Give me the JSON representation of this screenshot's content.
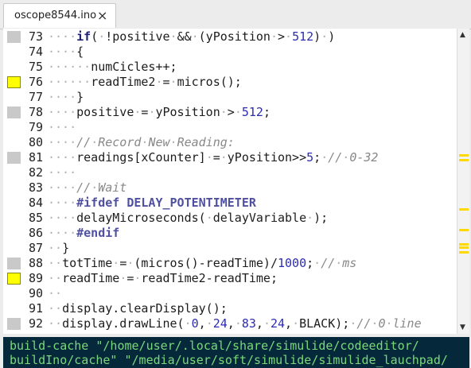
{
  "tab": {
    "title": "oscope8544.ino",
    "close_icon": "×"
  },
  "editor": {
    "lines": [
      {
        "num": "73",
        "marker": "gray",
        "tokens": [
          {
            "t": "····",
            "c": "dot"
          },
          {
            "t": "if",
            "c": "kw"
          },
          {
            "t": "("
          },
          {
            "t": "·",
            "c": "dot"
          },
          {
            "t": "!positive"
          },
          {
            "t": "·",
            "c": "dot"
          },
          {
            "t": "&&"
          },
          {
            "t": "·",
            "c": "dot"
          },
          {
            "t": "(yPosition"
          },
          {
            "t": "·",
            "c": "dot"
          },
          {
            "t": ">"
          },
          {
            "t": "·",
            "c": "dot"
          },
          {
            "t": "512",
            "c": "num"
          },
          {
            "t": ")"
          },
          {
            "t": "·",
            "c": "dot"
          },
          {
            "t": ")"
          }
        ]
      },
      {
        "num": "74",
        "marker": "none",
        "tokens": [
          {
            "t": "····",
            "c": "dot"
          },
          {
            "t": "{"
          }
        ]
      },
      {
        "num": "75",
        "marker": "none",
        "tokens": [
          {
            "t": "······",
            "c": "dot"
          },
          {
            "t": "numCicles++;"
          }
        ]
      },
      {
        "num": "76",
        "marker": "yellow",
        "tokens": [
          {
            "t": "······",
            "c": "dot"
          },
          {
            "t": "readTime2"
          },
          {
            "t": "·",
            "c": "dot"
          },
          {
            "t": "="
          },
          {
            "t": "·",
            "c": "dot"
          },
          {
            "t": "micros();"
          }
        ]
      },
      {
        "num": "77",
        "marker": "none",
        "tokens": [
          {
            "t": "····",
            "c": "dot"
          },
          {
            "t": "}"
          }
        ]
      },
      {
        "num": "78",
        "marker": "gray",
        "tokens": [
          {
            "t": "····",
            "c": "dot"
          },
          {
            "t": "positive"
          },
          {
            "t": "·",
            "c": "dot"
          },
          {
            "t": "="
          },
          {
            "t": "·",
            "c": "dot"
          },
          {
            "t": "yPosition"
          },
          {
            "t": "·",
            "c": "dot"
          },
          {
            "t": ">"
          },
          {
            "t": "·",
            "c": "dot"
          },
          {
            "t": "512",
            "c": "num"
          },
          {
            "t": ";"
          }
        ]
      },
      {
        "num": "79",
        "marker": "none",
        "tokens": [
          {
            "t": "····",
            "c": "dot"
          }
        ]
      },
      {
        "num": "80",
        "marker": "none",
        "tokens": [
          {
            "t": "····",
            "c": "dot"
          },
          {
            "t": "//",
            "c": "cm"
          },
          {
            "t": "·",
            "c": "dot"
          },
          {
            "t": "Record",
            "c": "cm"
          },
          {
            "t": "·",
            "c": "dot"
          },
          {
            "t": "New",
            "c": "cm"
          },
          {
            "t": "·",
            "c": "dot"
          },
          {
            "t": "Reading:",
            "c": "cm"
          }
        ]
      },
      {
        "num": "81",
        "marker": "gray",
        "tokens": [
          {
            "t": "····",
            "c": "dot"
          },
          {
            "t": "readings[xCounter]"
          },
          {
            "t": "·",
            "c": "dot"
          },
          {
            "t": "="
          },
          {
            "t": "·",
            "c": "dot"
          },
          {
            "t": "yPosition>>"
          },
          {
            "t": "5",
            "c": "num"
          },
          {
            "t": ";"
          },
          {
            "t": "·",
            "c": "dot"
          },
          {
            "t": "//",
            "c": "cm"
          },
          {
            "t": "·",
            "c": "dot"
          },
          {
            "t": "0-32",
            "c": "cm"
          }
        ]
      },
      {
        "num": "82",
        "marker": "none",
        "tokens": [
          {
            "t": "····",
            "c": "dot"
          }
        ]
      },
      {
        "num": "83",
        "marker": "none",
        "tokens": [
          {
            "t": "····",
            "c": "dot"
          },
          {
            "t": "//",
            "c": "cm"
          },
          {
            "t": "·",
            "c": "dot"
          },
          {
            "t": "Wait",
            "c": "cm"
          }
        ]
      },
      {
        "num": "84",
        "marker": "none",
        "tokens": [
          {
            "t": "····",
            "c": "dot"
          },
          {
            "t": "#ifdef",
            "c": "pp"
          },
          {
            "t": " "
          },
          {
            "t": "DELAY_POTENTIMETER",
            "c": "pp"
          }
        ]
      },
      {
        "num": "85",
        "marker": "none",
        "tokens": [
          {
            "t": "····",
            "c": "dot"
          },
          {
            "t": "delayMicroseconds("
          },
          {
            "t": "·",
            "c": "dot"
          },
          {
            "t": "delayVariable"
          },
          {
            "t": "·",
            "c": "dot"
          },
          {
            "t": ");"
          }
        ]
      },
      {
        "num": "86",
        "marker": "none",
        "tokens": [
          {
            "t": "····",
            "c": "dot"
          },
          {
            "t": "#endif",
            "c": "pp"
          }
        ]
      },
      {
        "num": "87",
        "marker": "none",
        "tokens": [
          {
            "t": "··",
            "c": "dot"
          },
          {
            "t": "}"
          }
        ]
      },
      {
        "num": "88",
        "marker": "gray",
        "tokens": [
          {
            "t": "··",
            "c": "dot"
          },
          {
            "t": "totTime"
          },
          {
            "t": "·",
            "c": "dot"
          },
          {
            "t": "="
          },
          {
            "t": "·",
            "c": "dot"
          },
          {
            "t": "(micros()-readTime)/"
          },
          {
            "t": "1000",
            "c": "num"
          },
          {
            "t": ";"
          },
          {
            "t": "·",
            "c": "dot"
          },
          {
            "t": "//",
            "c": "cm"
          },
          {
            "t": "·",
            "c": "dot"
          },
          {
            "t": "ms",
            "c": "cm"
          }
        ]
      },
      {
        "num": "89",
        "marker": "yellow",
        "tokens": [
          {
            "t": "··",
            "c": "dot"
          },
          {
            "t": "readTime"
          },
          {
            "t": "·",
            "c": "dot"
          },
          {
            "t": "="
          },
          {
            "t": "·",
            "c": "dot"
          },
          {
            "t": "readTime2-readTime;"
          }
        ]
      },
      {
        "num": "90",
        "marker": "none",
        "tokens": [
          {
            "t": "··",
            "c": "dot"
          }
        ]
      },
      {
        "num": "91",
        "marker": "none",
        "tokens": [
          {
            "t": "··",
            "c": "dot"
          },
          {
            "t": "display.clearDisplay();"
          }
        ]
      },
      {
        "num": "92",
        "marker": "gray",
        "tokens": [
          {
            "t": "··",
            "c": "dot"
          },
          {
            "t": "display.drawLine("
          },
          {
            "t": "·",
            "c": "dot"
          },
          {
            "t": "0",
            "c": "num"
          },
          {
            "t": ","
          },
          {
            "t": "·",
            "c": "dot"
          },
          {
            "t": "24",
            "c": "num"
          },
          {
            "t": ","
          },
          {
            "t": "·",
            "c": "dot"
          },
          {
            "t": "83",
            "c": "num"
          },
          {
            "t": ","
          },
          {
            "t": "·",
            "c": "dot"
          },
          {
            "t": "24",
            "c": "num"
          },
          {
            "t": ","
          },
          {
            "t": "·",
            "c": "dot"
          },
          {
            "t": "BLACK);"
          },
          {
            "t": "·",
            "c": "dot"
          },
          {
            "t": "//",
            "c": "cm"
          },
          {
            "t": "·",
            "c": "dot"
          },
          {
            "t": "0",
            "c": "cm"
          },
          {
            "t": "·",
            "c": "dot"
          },
          {
            "t": "line",
            "c": "cm"
          }
        ]
      }
    ]
  },
  "scrollbar": {
    "up_arrow": "▲",
    "down_arrow": "▼"
  },
  "console": {
    "lines": [
      "build-cache \"/home/user/.local/share/simulide/codeeditor/",
      "buildIno/cache\" \"/media/user/soft/simulide/simulide_lauchpad/"
    ]
  }
}
